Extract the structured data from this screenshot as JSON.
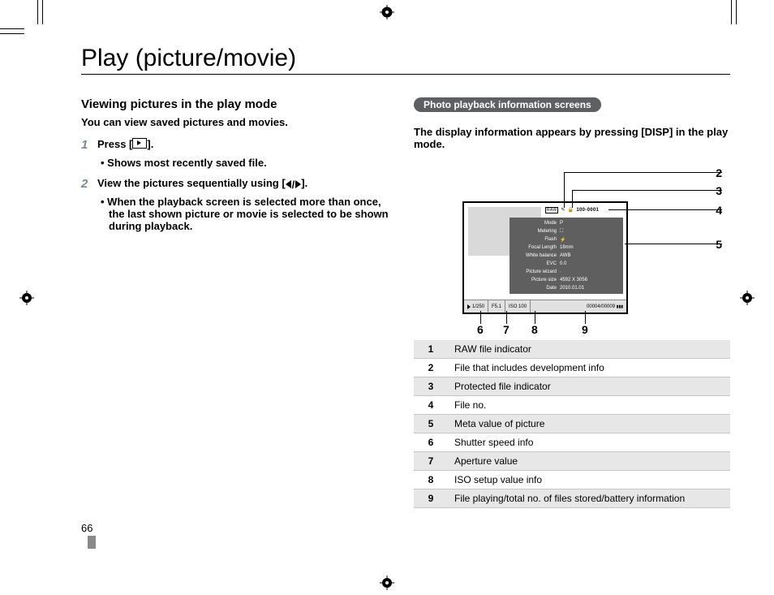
{
  "title": "Play (picture/movie)",
  "left": {
    "heading": "Viewing pictures in the play mode",
    "intro": "You can view saved pictures and movies.",
    "step1_num": "1",
    "step1_text_a": "Press [",
    "step1_text_b": "].",
    "step1_bullet": "Shows most recently saved file.",
    "step2_num": "2",
    "step2_text_a": "View the pictures sequentially using [",
    "step2_text_b": "].",
    "step2_bullet": "When the playback screen is selected more than once, the last shown picture or movie is selected to be shown during playback."
  },
  "right": {
    "pill": "Photo playback information screens",
    "disp_line": "The display information appears by pressing [DISP] in the play mode.",
    "screen": {
      "top": {
        "raw": "RAW",
        "dev": "✎",
        "lock": "🔒",
        "fileno": "100-0001"
      },
      "meta_rows": [
        {
          "lab": "Mode",
          "val": "P"
        },
        {
          "lab": "Metering",
          "val": "⛶"
        },
        {
          "lab": "Flash",
          "val": "⚡"
        },
        {
          "lab": "Focal Length",
          "val": "18mm"
        },
        {
          "lab": "White balance",
          "val": "AWB"
        },
        {
          "lab": "EVC",
          "val": "0.0"
        },
        {
          "lab": "Picture wizard",
          "val": "·"
        },
        {
          "lab": "Picture size",
          "val": "4592 X 3056"
        },
        {
          "lab": "Date",
          "val": "2010.01.01"
        }
      ],
      "bottom": {
        "shutter": "1/250",
        "aperture": "F5.1",
        "iso": "ISO  100",
        "count": "00004/00009",
        "batt": "▮▮▮"
      }
    },
    "callouts": [
      "2",
      "3",
      "4",
      "5",
      "6",
      "7",
      "8",
      "9"
    ]
  },
  "legend": [
    {
      "n": "1",
      "d": "RAW file indicator"
    },
    {
      "n": "2",
      "d": "File that includes development info"
    },
    {
      "n": "3",
      "d": "Protected file indicator"
    },
    {
      "n": "4",
      "d": "File no."
    },
    {
      "n": "5",
      "d": "Meta value of picture"
    },
    {
      "n": "6",
      "d": "Shutter speed info"
    },
    {
      "n": "7",
      "d": "Aperture value"
    },
    {
      "n": "8",
      "d": "ISO setup value info"
    },
    {
      "n": "9",
      "d": "File playing/total no. of files stored/battery information"
    }
  ],
  "page_no": "66"
}
